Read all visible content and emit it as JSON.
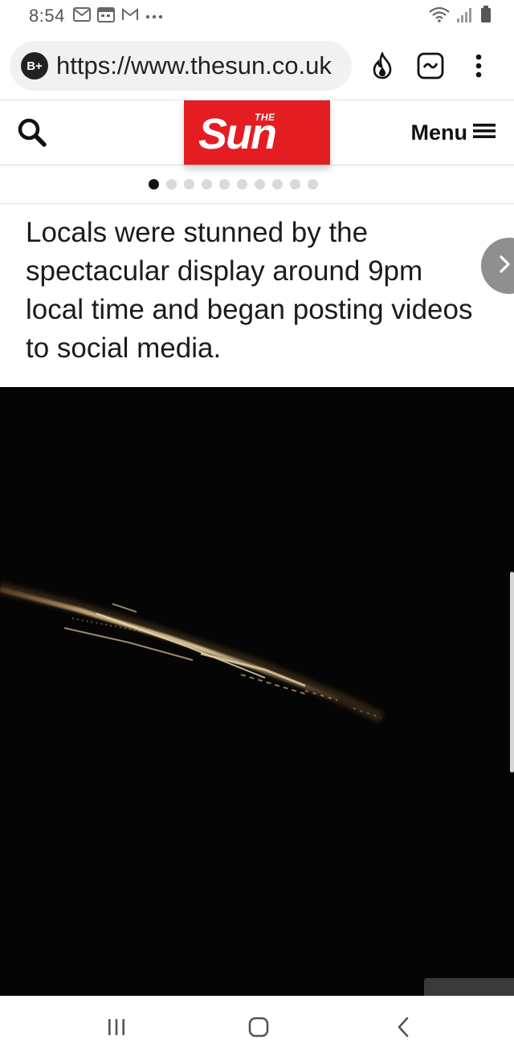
{
  "status_bar": {
    "time": "8:54",
    "notification_icons": [
      "mail-icon",
      "calendar-icon",
      "gmail-icon",
      "more-dots-icon"
    ],
    "right_icons": [
      "wifi-icon",
      "signal-icon",
      "battery-icon"
    ]
  },
  "browser": {
    "badge": "B+",
    "url": "https://www.thesun.co.uk",
    "icons": [
      "flame-icon",
      "trending-icon",
      "overflow-menu-icon"
    ]
  },
  "site_header": {
    "logo_the": "THE",
    "logo_name": "Sun",
    "menu_label": "Menu"
  },
  "carousel": {
    "total_dots": 10,
    "active_index": 0
  },
  "slide": {
    "caption": "Locals were stunned by the spectacular display around 9pm local time and began posting videos to social media.",
    "image_alt": "streak of burning debris across a dark night sky"
  },
  "nav_bar": {
    "buttons": [
      "recent-apps",
      "home",
      "back"
    ]
  },
  "colors": {
    "sun_red": "#e41d23",
    "photo_background": "#060505",
    "streak": "#e8d6a8"
  }
}
